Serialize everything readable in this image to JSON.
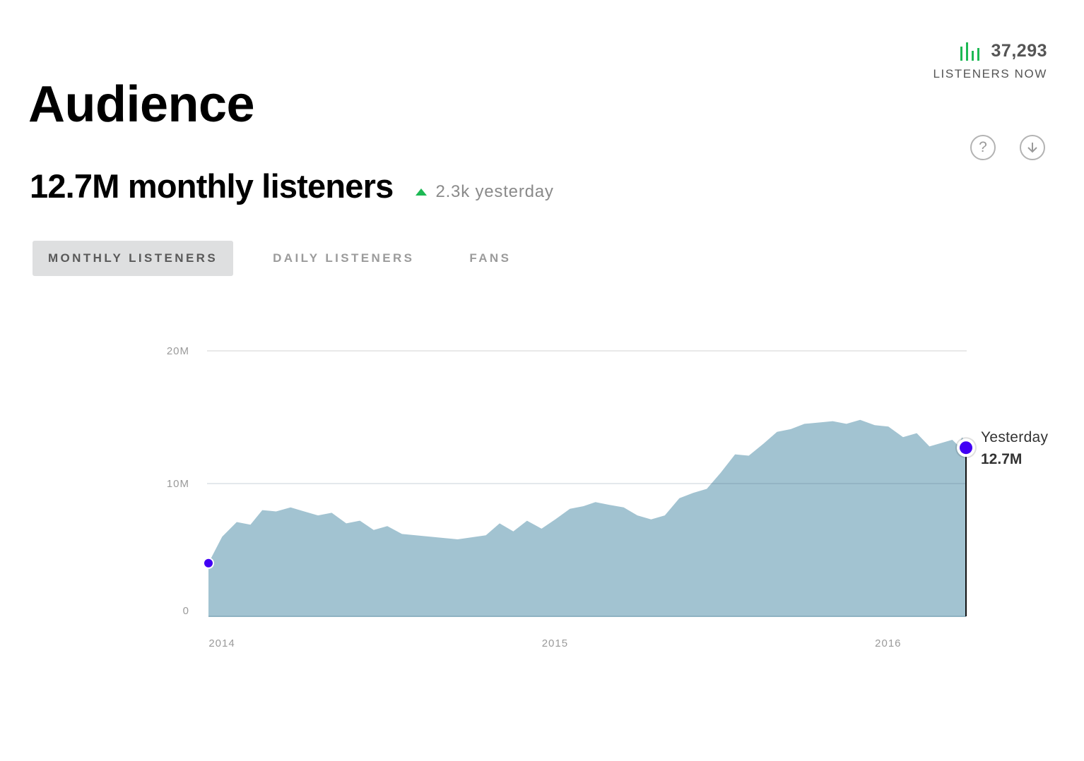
{
  "page": {
    "title": "Audience"
  },
  "live": {
    "count": "37,293",
    "label": "LISTENERS NOW",
    "icon": "bar-chart-icon",
    "icon_color": "#1db954"
  },
  "header_actions": [
    {
      "name": "help",
      "icon": "question-circle-icon"
    },
    {
      "name": "download",
      "icon": "download-circle-icon"
    }
  ],
  "summary": {
    "value": "12.7M monthly listeners",
    "delta_icon": "up-triangle-icon",
    "delta_color": "#1db954",
    "delta_text": "2.3k yesterday"
  },
  "tabs": [
    {
      "label": "MONTHLY LISTENERS",
      "active": true
    },
    {
      "label": "DAILY LISTENERS",
      "active": false
    },
    {
      "label": "FANS",
      "active": false
    }
  ],
  "chart_data": {
    "type": "area",
    "title": "",
    "xlabel": "",
    "ylabel": "",
    "x_axis": {
      "type": "date",
      "range": [
        "2014-01-01",
        "2016-04-10"
      ],
      "ticks": [
        "2014",
        "2015",
        "2016"
      ]
    },
    "y_axis": {
      "range": [
        0,
        20000000
      ],
      "ticks": [
        "0",
        "10M",
        "20M"
      ]
    },
    "grid": true,
    "legend": "none",
    "fill_color": "#a2c3d1",
    "marker_color": "#4100f4",
    "series": [
      {
        "points": [
          [
            "2014-01-01",
            4000000
          ],
          [
            "2014-01-16",
            6000000
          ],
          [
            "2014-02-01",
            7100000
          ],
          [
            "2014-02-16",
            6900000
          ],
          [
            "2014-03-01",
            8000000
          ],
          [
            "2014-03-16",
            7900000
          ],
          [
            "2014-04-01",
            8200000
          ],
          [
            "2014-04-16",
            7900000
          ],
          [
            "2014-05-01",
            7600000
          ],
          [
            "2014-05-16",
            7800000
          ],
          [
            "2014-06-01",
            7000000
          ],
          [
            "2014-06-16",
            7200000
          ],
          [
            "2014-07-01",
            6500000
          ],
          [
            "2014-07-16",
            6800000
          ],
          [
            "2014-08-01",
            6200000
          ],
          [
            "2014-09-01",
            6000000
          ],
          [
            "2014-10-01",
            5800000
          ],
          [
            "2014-11-01",
            6100000
          ],
          [
            "2014-11-16",
            7000000
          ],
          [
            "2014-12-01",
            6400000
          ],
          [
            "2014-12-16",
            7200000
          ],
          [
            "2015-01-01",
            6600000
          ],
          [
            "2015-01-16",
            7300000
          ],
          [
            "2015-02-01",
            8100000
          ],
          [
            "2015-02-16",
            8300000
          ],
          [
            "2015-03-01",
            8600000
          ],
          [
            "2015-03-16",
            8400000
          ],
          [
            "2015-04-01",
            8200000
          ],
          [
            "2015-04-16",
            7600000
          ],
          [
            "2015-05-01",
            7300000
          ],
          [
            "2015-05-16",
            7600000
          ],
          [
            "2015-06-01",
            8900000
          ],
          [
            "2015-06-16",
            9300000
          ],
          [
            "2015-07-01",
            9600000
          ],
          [
            "2015-07-16",
            10800000
          ],
          [
            "2015-08-01",
            12200000
          ],
          [
            "2015-08-16",
            12100000
          ],
          [
            "2015-09-01",
            13000000
          ],
          [
            "2015-09-16",
            13900000
          ],
          [
            "2015-10-01",
            14100000
          ],
          [
            "2015-10-16",
            14500000
          ],
          [
            "2015-11-01",
            14600000
          ],
          [
            "2015-11-16",
            14700000
          ],
          [
            "2015-12-01",
            14500000
          ],
          [
            "2015-12-16",
            14800000
          ],
          [
            "2016-01-01",
            14400000
          ],
          [
            "2016-01-16",
            14300000
          ],
          [
            "2016-02-01",
            13500000
          ],
          [
            "2016-02-16",
            13800000
          ],
          [
            "2016-03-01",
            12800000
          ],
          [
            "2016-03-16",
            13100000
          ],
          [
            "2016-03-26",
            13300000
          ],
          [
            "2016-04-01",
            12900000
          ],
          [
            "2016-04-06",
            13500000
          ],
          [
            "2016-04-10",
            12700000
          ]
        ]
      }
    ],
    "tooltip": {
      "label": "Yesterday",
      "value": "12.7M"
    }
  }
}
